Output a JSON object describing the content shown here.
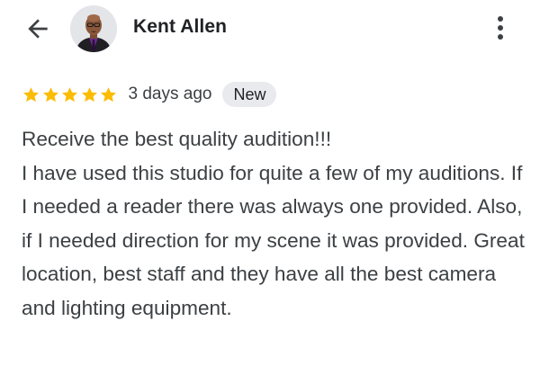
{
  "header": {
    "back_icon": "arrow-left-icon",
    "reviewer_name": "Kent Allen",
    "more_icon": "more-vert-icon"
  },
  "rating": {
    "stars": 5,
    "max_stars": 5,
    "star_color": "#fbbc04",
    "date": "3 days ago",
    "badge": "New"
  },
  "review": {
    "lines": [
      "Receive the best quality audition!!!",
      "I have used this studio for quite a few of my auditions. If I needed a reader there was always one provided. Also, if I needed direction for my scene it was provided. Great location, best staff and they have all the best camera and lighting equipment."
    ]
  },
  "colors": {
    "text_primary": "#202124",
    "text_secondary": "#3c4043",
    "badge_bg": "#e8eaed"
  }
}
